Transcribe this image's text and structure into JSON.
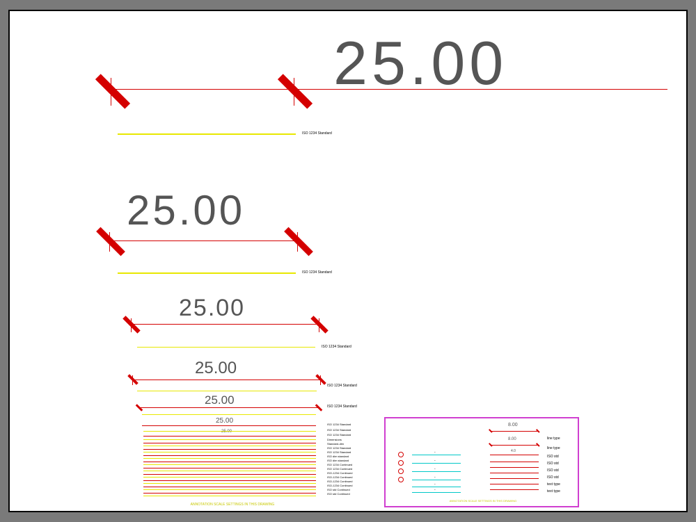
{
  "dimensions": {
    "main_value": "25.00",
    "d2_value": "25.00",
    "d3_value": "25.00",
    "d4_value": "25.00",
    "d5_value": "25.00",
    "d6_value": "25.00",
    "d7_value": "25.00"
  },
  "labels": {
    "l1": "ISO 1234 Standard",
    "l2": "ISO 1234 Standard",
    "l3": "ISO 1234 Standard",
    "l4": "ISO 1234 Standard",
    "l5": "ISO 1234 Standard",
    "l6": "ISO 1234 Standard"
  },
  "stack_labels": [
    "ISO 1234 Standard",
    "ISO 1234 Standard",
    "Dimensions",
    "Standard-dim",
    "ISO 1234 Standard",
    "ISO 1234 Standard",
    "ISO dim standard",
    "ISO dim standard",
    "ISO 1234 Continued",
    "ISO 1234 Continued",
    "ISO-1234 Continued",
    "ISO-1234 Continued",
    "ISO-1234 Continued",
    "ISO-1234 Continued",
    "ISO std Continued",
    "ISO std Continued"
  ],
  "legend": {
    "dim1": "8.00",
    "dim2": "8.00",
    "dim3": "4.0",
    "left_labels": [
      "-",
      "-",
      "-",
      "-",
      "-",
      "-"
    ],
    "right_labels": [
      "line type",
      "line type",
      "ISO std",
      "ISO std",
      "ISO std",
      "ISO std",
      "text type",
      "text type"
    ]
  },
  "footer": "ANNOTATION SCALE SETTINGS IN THIS DRAWING"
}
